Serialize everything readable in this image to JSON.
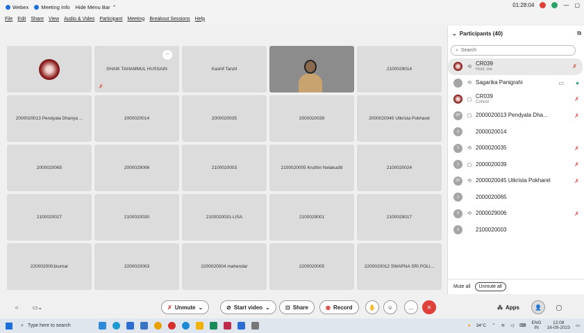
{
  "titlebar": {
    "app": "Webex",
    "meeting_info": "Meeting Info",
    "hide_menu": "Hide Menu Bar",
    "timer": "01:28:04"
  },
  "menu": [
    "File",
    "Edit",
    "Share",
    "View",
    "Audio & Video",
    "Participant",
    "Meeting",
    "Breakout Sessions",
    "Help"
  ],
  "tiles": [
    "",
    "SHAIK TAHAMMUL HUSSAIN",
    "Kashif Tanzil",
    "",
    "2100029014",
    "2000020013 Pendyala  Dhanya ...",
    "2000020014",
    "2000020035",
    "2000020039",
    "2000020045 Utkrista Pokharel",
    "2000020065",
    "2000029006",
    "2100020003",
    "2100020005 Kruthin Nelakuditi",
    "2100020024",
    "2100020027",
    "2100020030",
    "2100020031-LISA",
    "2100029001",
    "2100029017",
    "2200020001kumar",
    "2200020003",
    "2200020004 mahendar",
    "2200020005",
    "2200020012 SWAPNA SRI POLI..."
  ],
  "tile_more": "...",
  "panel": {
    "title": "Participants (40)",
    "search_placeholder": "Search",
    "participants": [
      {
        "avatar": "",
        "name": "CR039",
        "sub": "Host, me"
      },
      {
        "avatar": "",
        "name": "Sagarika Panigrahi",
        "sub": ""
      },
      {
        "avatar": "",
        "name": "CR039",
        "sub": "Cohost"
      },
      {
        "avatar": "2P",
        "name": "2000020013 Pendyala  Dha...",
        "sub": ""
      },
      {
        "avatar": "2",
        "name": "2000020014",
        "sub": ""
      },
      {
        "avatar": "2",
        "name": "2000020035",
        "sub": ""
      },
      {
        "avatar": "2",
        "name": "2000020039",
        "sub": ""
      },
      {
        "avatar": "2P",
        "name": "2000020045 Utkrista Pokharel",
        "sub": ""
      },
      {
        "avatar": "2",
        "name": "2000020065",
        "sub": ""
      },
      {
        "avatar": "2",
        "name": "2000029006",
        "sub": ""
      },
      {
        "avatar": "2",
        "name": "2100020003",
        "sub": ""
      }
    ],
    "mute_all": "Mute all",
    "unmute_all": "Unmute all"
  },
  "controls": {
    "unmute": "Unmute",
    "start_video": "Start video",
    "share": "Share",
    "record": "Record",
    "apps": "Apps",
    "more": "..."
  },
  "taskbar": {
    "search_placeholder": "Type here to search",
    "weather": "34°C",
    "lang": "ENG",
    "region": "IN",
    "time": "12:08",
    "date": "16-09-2023"
  },
  "colors": {
    "accent_red": "#e0403a",
    "webex_blue": "#1d6fd6",
    "green": "#29a36a"
  }
}
